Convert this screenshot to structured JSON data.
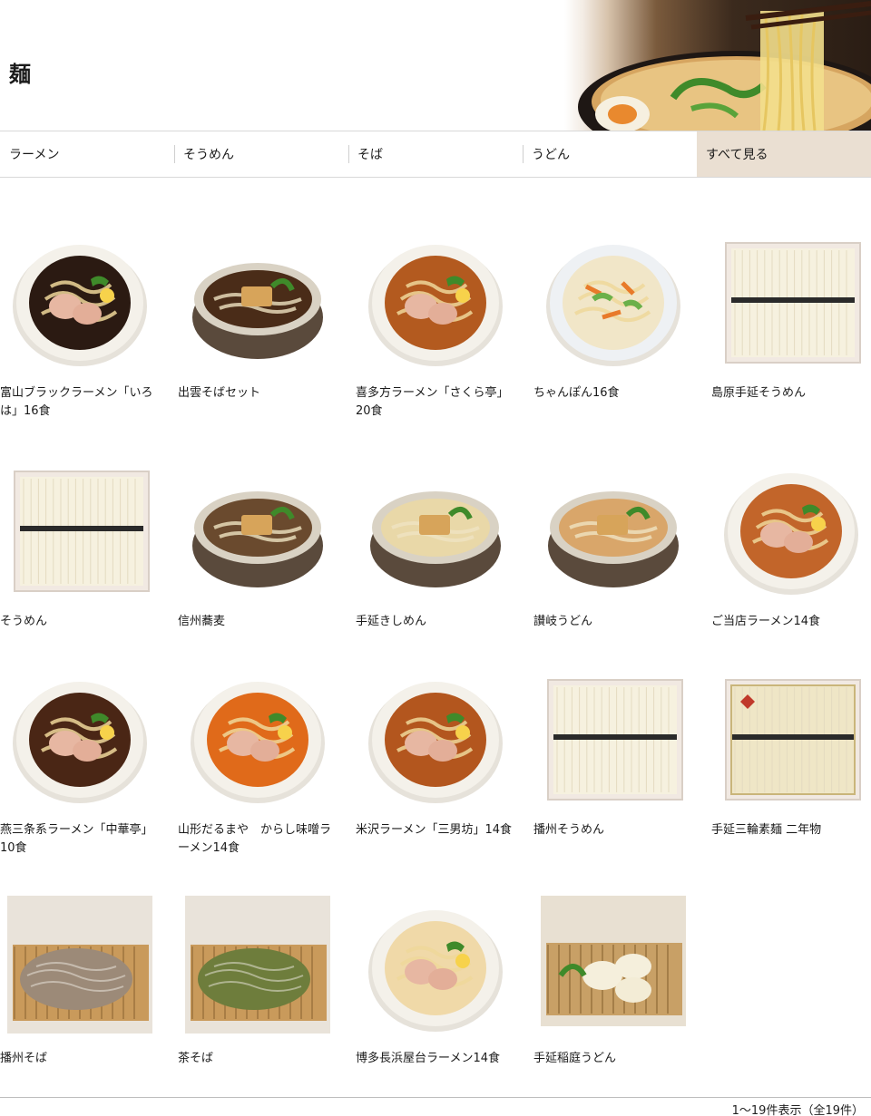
{
  "page": {
    "title": "麺"
  },
  "tabs": [
    {
      "label": "ラーメン"
    },
    {
      "label": "そうめん"
    },
    {
      "label": "そば"
    },
    {
      "label": "うどん"
    },
    {
      "label": "すべて見る"
    }
  ],
  "products": [
    {
      "name": "富山ブラックラーメン「いろは」16食",
      "kind": "ramen",
      "broth": "#2b1a12"
    },
    {
      "name": "出雲そばセット",
      "kind": "soba-bowl",
      "broth": "#4a2c18"
    },
    {
      "name": "喜多方ラーメン「さくら亭」20食",
      "kind": "ramen",
      "broth": "#b35a1f"
    },
    {
      "name": "ちゃんぽん16食",
      "kind": "champon",
      "broth": "#f1e6c8"
    },
    {
      "name": "島原手延そうめん",
      "kind": "somen-box"
    },
    {
      "name": "そうめん",
      "kind": "somen-box"
    },
    {
      "name": "信州蕎麦",
      "kind": "soba-bowl",
      "broth": "#6a4a2e"
    },
    {
      "name": "手延きしめん",
      "kind": "udon-bowl",
      "broth": "#e9d8a8"
    },
    {
      "name": "讃岐うどん",
      "kind": "udon-bowl",
      "broth": "#d9a66a"
    },
    {
      "name": "ご当店ラーメン14食",
      "kind": "ramen",
      "broth": "#c2652a"
    },
    {
      "name": "燕三条系ラーメン「中華亭」10食",
      "kind": "ramen",
      "broth": "#4a2615"
    },
    {
      "name": "山形だるまや　からし味噌ラーメン14食",
      "kind": "ramen",
      "broth": "#e06a1a"
    },
    {
      "name": "米沢ラーメン「三男坊」14食",
      "kind": "ramen",
      "broth": "#b3561e"
    },
    {
      "name": "播州そうめん",
      "kind": "somen-box"
    },
    {
      "name": "手延三輪素麺 二年物",
      "kind": "somen-box-gold"
    },
    {
      "name": "播州そば",
      "kind": "zaru-soba",
      "noodle": "#9c8a78"
    },
    {
      "name": "茶そば",
      "kind": "zaru-soba",
      "noodle": "#6e7d3c"
    },
    {
      "name": "博多長浜屋台ラーメン14食",
      "kind": "ramen",
      "broth": "#f0d9a8"
    },
    {
      "name": "手延稲庭うどん",
      "kind": "inaniwa"
    }
  ],
  "footer": {
    "count_text": "1～19件表示（全19件）"
  }
}
